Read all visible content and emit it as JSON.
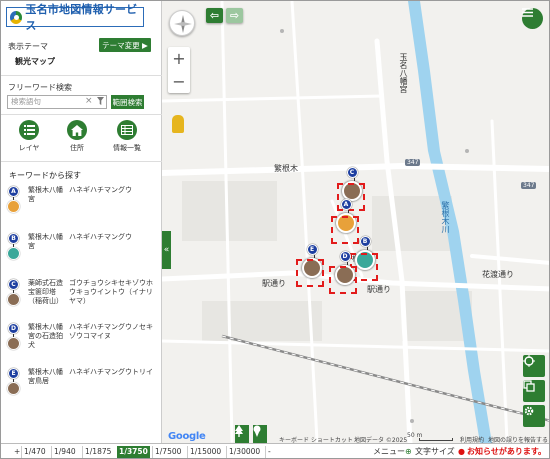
{
  "app_title": "玉名市地図情報サービス",
  "sidebar": {
    "theme_label": "表示テーマ",
    "theme_change_button": "テーマ変更 ▶",
    "theme_name": "観光マップ",
    "freeword_label": "フリーワード検索",
    "search_placeholder": "検索語句",
    "range_search_button": "範囲検索",
    "tools": [
      {
        "label": "レイヤ",
        "icon": "list-icon"
      },
      {
        "label": "住所",
        "icon": "home-icon"
      },
      {
        "label": "情報一覧",
        "icon": "table-icon"
      }
    ],
    "keyword_title": "キーワードから探す",
    "results": [
      {
        "badge": "A",
        "name": "繁根木八幡宮",
        "kana": "ハネギハチマングウ",
        "color": "#e8a13a"
      },
      {
        "badge": "B",
        "name": "繁根木八幡宮",
        "kana": "ハネギハチマングウ",
        "color": "#3aa89a"
      },
      {
        "badge": "C",
        "name": "薬師式石造宝篋印塔（稲荷山）",
        "kana": "ゴウチョウシキセキゾウホウキョウイントウ（イナリヤマ）",
        "color": "#8a6d55"
      },
      {
        "badge": "D",
        "name": "繁根木八幡宮の石造狛犬",
        "kana": "ハネギハチマングウノセキゾウコマイヌ",
        "color": "#8a6d55"
      },
      {
        "badge": "E",
        "name": "繁根木八幡宮鳥居",
        "kana": "ハネギハチマングウトリイ",
        "color": "#8a6d55"
      }
    ]
  },
  "map": {
    "road_labels": [
      "繁根木",
      "駅通り",
      "駅通り",
      "花渡通り",
      "根木",
      "繁根木川",
      "玉名八幡宮"
    ],
    "route_numbers": [
      "347",
      "347"
    ],
    "markers": [
      "C",
      "A",
      "B",
      "D",
      "E"
    ],
    "google_logo": "Google",
    "attribution": {
      "shortcuts": "キーボード ショートカット",
      "map_data": "地図データ ©2025",
      "scale": "50 m",
      "terms": "利用規約",
      "report": "地図の誤りを報告する"
    }
  },
  "bottom_bar": {
    "plus": "+",
    "scales": [
      "1/470",
      "1/940",
      "1/1875",
      "1/3750",
      "1/7500",
      "1/15000",
      "1/30000"
    ],
    "active_scale": "1/3750",
    "minus": "-",
    "menu": "メニュー",
    "text_size": "文字サイズ",
    "notice": "お知らせがあります。"
  },
  "colors": {
    "accent_green": "#2e7d32",
    "badge_blue": "#1e3fa0",
    "selection_red": "#e21b1b",
    "river": "#9fd3ef"
  }
}
